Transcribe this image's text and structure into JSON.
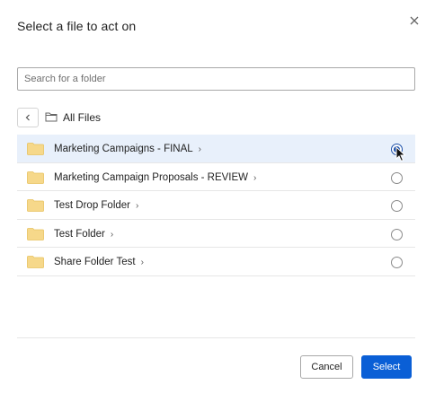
{
  "dialog": {
    "title": "Select a file to act on",
    "close_icon": "close-icon"
  },
  "search": {
    "placeholder": "Search for a folder",
    "value": ""
  },
  "breadcrumb": {
    "back_icon": "chevron-left-icon",
    "folder_icon": "folder-outline-icon",
    "label": "All Files"
  },
  "folders": [
    {
      "name": "Marketing Campaigns - FINAL",
      "selected": true
    },
    {
      "name": "Marketing Campaign Proposals - REVIEW",
      "selected": false
    },
    {
      "name": "Test Drop Folder",
      "selected": false
    },
    {
      "name": "Test Folder",
      "selected": false
    },
    {
      "name": "Share Folder Test",
      "selected": false
    }
  ],
  "footer": {
    "cancel_label": "Cancel",
    "select_label": "Select"
  },
  "colors": {
    "accent": "#0a5fd6",
    "selected_row": "#e8f0fb",
    "folder_fill": "#f6d88a"
  }
}
